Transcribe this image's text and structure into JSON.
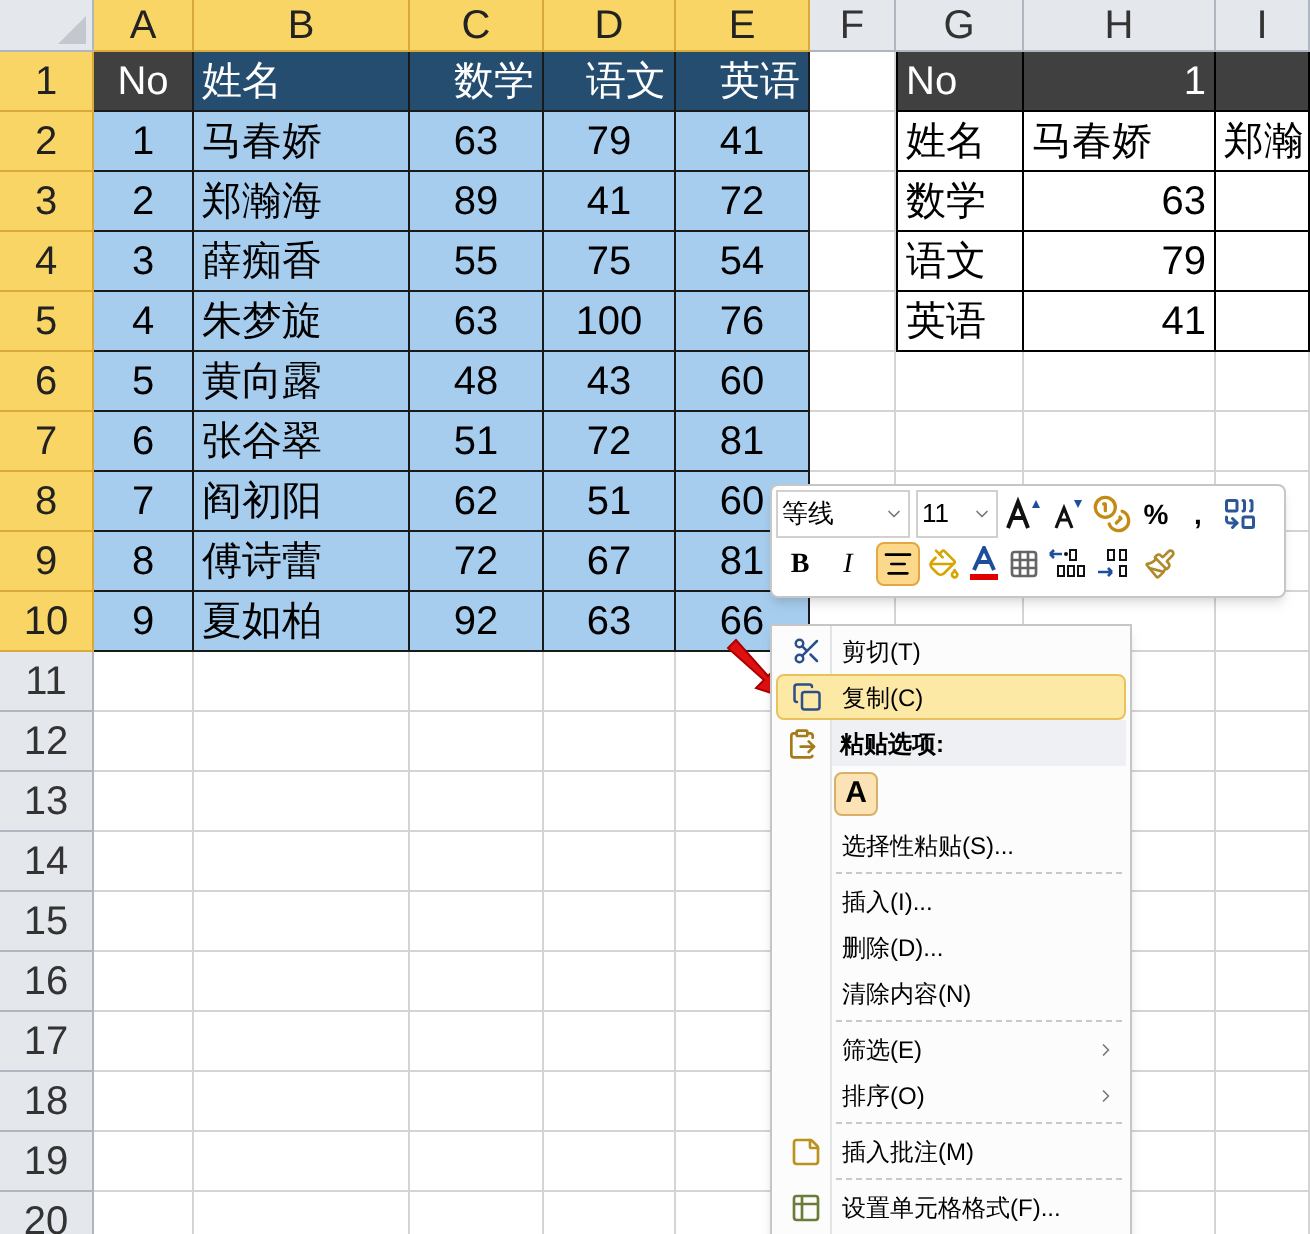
{
  "column_headers": [
    {
      "label": "A",
      "selected": true
    },
    {
      "label": "B",
      "selected": true
    },
    {
      "label": "C",
      "selected": true
    },
    {
      "label": "D",
      "selected": true
    },
    {
      "label": "E",
      "selected": true
    },
    {
      "label": "F",
      "selected": false
    },
    {
      "label": "G",
      "selected": false
    },
    {
      "label": "H",
      "selected": false
    },
    {
      "label": "I",
      "selected": false
    }
  ],
  "row_headers": [
    {
      "label": "1",
      "selected": true
    },
    {
      "label": "2",
      "selected": true
    },
    {
      "label": "3",
      "selected": true
    },
    {
      "label": "4",
      "selected": true
    },
    {
      "label": "5",
      "selected": true
    },
    {
      "label": "6",
      "selected": true
    },
    {
      "label": "7",
      "selected": true
    },
    {
      "label": "8",
      "selected": true
    },
    {
      "label": "9",
      "selected": true
    },
    {
      "label": "10",
      "selected": true
    },
    {
      "label": "11",
      "selected": false
    },
    {
      "label": "12",
      "selected": false
    },
    {
      "label": "13",
      "selected": false
    },
    {
      "label": "14",
      "selected": false
    },
    {
      "label": "15",
      "selected": false
    },
    {
      "label": "16",
      "selected": false
    },
    {
      "label": "17",
      "selected": false
    },
    {
      "label": "18",
      "selected": false
    },
    {
      "label": "19",
      "selected": false
    },
    {
      "label": "20",
      "selected": false
    }
  ],
  "score_table": {
    "header": [
      "No",
      "姓名",
      "数学",
      "语文",
      "英语"
    ],
    "rows": [
      [
        "1",
        "马春娇",
        "63",
        "79",
        "41"
      ],
      [
        "2",
        "郑瀚海",
        "89",
        "41",
        "72"
      ],
      [
        "3",
        "薛痴香",
        "55",
        "75",
        "54"
      ],
      [
        "4",
        "朱梦旋",
        "63",
        "100",
        "76"
      ],
      [
        "5",
        "黄向露",
        "48",
        "43",
        "60"
      ],
      [
        "6",
        "张谷翠",
        "51",
        "72",
        "81"
      ],
      [
        "7",
        "阎初阳",
        "62",
        "51",
        "60"
      ],
      [
        "8",
        "傅诗蕾",
        "72",
        "67",
        "81"
      ],
      [
        "9",
        "夏如柏",
        "92",
        "63",
        "66"
      ]
    ]
  },
  "transposed_table": {
    "rows": [
      [
        "No",
        "1"
      ],
      [
        "姓名",
        "马春娇",
        "郑瀚"
      ],
      [
        "数学",
        "63"
      ],
      [
        "语文",
        "79"
      ],
      [
        "英语",
        "41"
      ]
    ]
  },
  "mini_toolbar": {
    "font": "等线",
    "size": "11",
    "row_1": [
      {
        "kind": "grow"
      },
      {
        "kind": "shrink"
      },
      {
        "kind": "currency"
      },
      {
        "kind": "text",
        "label": "%"
      },
      {
        "kind": "text",
        "label": ","
      },
      {
        "kind": "merge"
      }
    ],
    "row_2": [
      {
        "kind": "bold",
        "label": "B",
        "selected": false
      },
      {
        "kind": "italic",
        "label": "I",
        "selected": false
      },
      {
        "kind": "align",
        "selected": true
      },
      {
        "kind": "fill"
      },
      {
        "kind": "fontcolor"
      },
      {
        "kind": "borders"
      },
      {
        "kind": "inc"
      },
      {
        "kind": "dec"
      },
      {
        "kind": "painter"
      }
    ]
  },
  "context_menu": [
    {
      "kind": "cut",
      "label": "剪切(T)",
      "selected": false
    },
    {
      "kind": "copy",
      "label": "复制(C)",
      "selected": true
    },
    {
      "kind": "header",
      "label": "粘贴选项:"
    },
    {
      "kind": "paste_option",
      "label": "A"
    },
    {
      "kind": "item",
      "label": "选择性粘贴(S)...",
      "selected": false
    },
    {
      "kind": "separator"
    },
    {
      "kind": "item",
      "label": "插入(I)...",
      "selected": false
    },
    {
      "kind": "item",
      "label": "删除(D)...",
      "selected": false
    },
    {
      "kind": "item",
      "label": "清除内容(N)",
      "selected": false
    },
    {
      "kind": "separator"
    },
    {
      "kind": "item",
      "label": "筛选(E)",
      "submenu": true,
      "selected": false
    },
    {
      "kind": "item",
      "label": "排序(O)",
      "submenu": true,
      "selected": false
    },
    {
      "kind": "separator"
    },
    {
      "kind": "comment",
      "label": "插入批注(M)",
      "selected": false
    },
    {
      "kind": "separator"
    },
    {
      "kind": "format",
      "label": "设置单元格格式(F)...",
      "selected": false
    }
  ]
}
